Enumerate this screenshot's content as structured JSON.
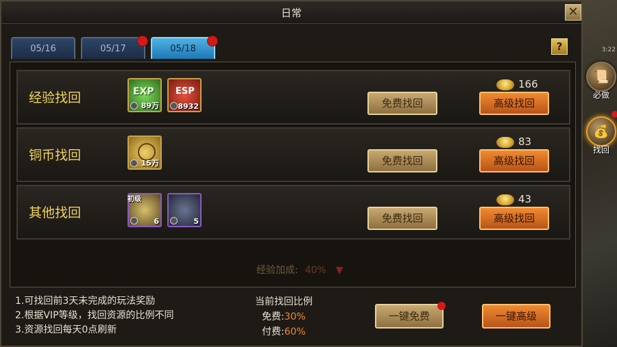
{
  "window": {
    "title": "日常",
    "close_label": "✕",
    "help_label": "?"
  },
  "side": {
    "time": "3:22",
    "items": [
      {
        "label": "必做",
        "icon": "scroll-icon"
      },
      {
        "label": "找回",
        "icon": "bag-icon"
      }
    ]
  },
  "tabs": [
    {
      "label": "05/16",
      "active": false,
      "badge": false
    },
    {
      "label": "05/17",
      "active": false,
      "badge": true
    },
    {
      "label": "05/18",
      "active": true,
      "badge": true
    }
  ],
  "rows": [
    {
      "title": "经验找回",
      "items": [
        {
          "name": "exp-item",
          "count": "89万",
          "tag": "",
          "color": "#3d8a2e",
          "label": "EXP"
        },
        {
          "name": "esp-item",
          "count": "8932",
          "tag": "",
          "color": "#b52a1c",
          "label": "ESP"
        }
      ],
      "free_label": "免费找回",
      "adv_label": "高级找回",
      "gold": "166"
    },
    {
      "title": "铜币找回",
      "items": [
        {
          "name": "copper-coin-item",
          "count": "15万",
          "tag": "",
          "color": "#a8801f",
          "label": ""
        }
      ],
      "free_label": "免费找回",
      "adv_label": "高级找回",
      "gold": "83"
    },
    {
      "title": "其他找回",
      "items": [
        {
          "name": "bag-item",
          "count": "6",
          "tag": "初级",
          "color": "#8f7a3a",
          "label": ""
        },
        {
          "name": "ore-item",
          "count": "5",
          "tag": "",
          "color": "#3e4660",
          "label": ""
        }
      ],
      "free_label": "免费找回",
      "adv_label": "高级找回",
      "gold": "43"
    }
  ],
  "bonus": {
    "label": "经验加成:",
    "value": "40%"
  },
  "notes": [
    "1.可找回前3天未完成的玩法奖励",
    "2.根据VIP等级，找回资源的比例不同",
    "3.资源找回每天0点刷新"
  ],
  "ratio": {
    "title": "当前找回比例",
    "free_label": "免费:",
    "free_value": "30%",
    "paid_label": "付费:",
    "paid_value": "60%"
  },
  "footer": {
    "onekey_free": "一键免费",
    "onekey_adv": "一键高级"
  },
  "colors": {
    "accent_gold": "#f2d35a",
    "tab_active": "#3aa0d8",
    "badge_red": "#d51818",
    "orange": "#f08a30"
  }
}
